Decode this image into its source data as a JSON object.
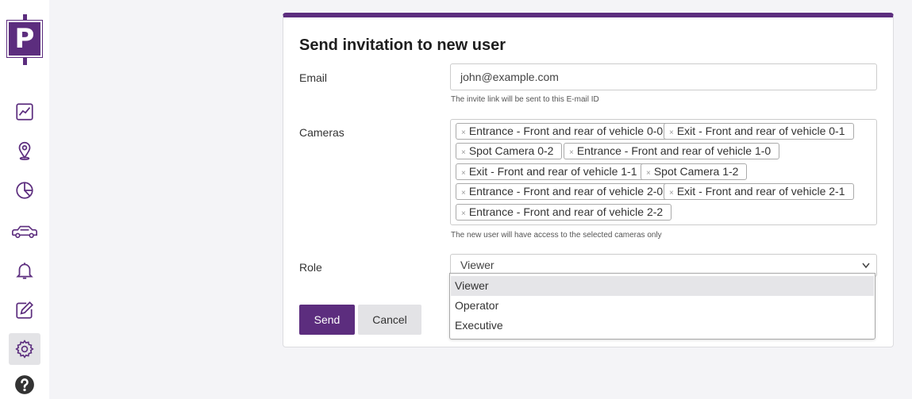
{
  "sidebar": {
    "logo_letter": "P",
    "items": [
      {
        "icon": "chart-line-icon"
      },
      {
        "icon": "map-pin-icon"
      },
      {
        "icon": "pie-chart-icon"
      },
      {
        "icon": "car-icon"
      },
      {
        "icon": "bell-icon"
      },
      {
        "icon": "edit-icon"
      },
      {
        "icon": "gear-icon",
        "active": true
      },
      {
        "icon": "help-icon"
      }
    ]
  },
  "form": {
    "title": "Send invitation to new user",
    "email_label": "Email",
    "email_value": "john@example.com",
    "email_help": "The invite link will be sent to this E-mail ID",
    "cameras_label": "Cameras",
    "cameras": [
      "Entrance - Front and rear of vehicle 0-0",
      "Exit - Front and rear of vehicle 0-1",
      "Spot Camera 0-2",
      "Entrance - Front and rear of vehicle 1-0",
      "Exit - Front and rear of vehicle 1-1",
      "Spot Camera 1-2",
      "Entrance - Front and rear of vehicle 2-0",
      "Exit - Front and rear of vehicle 2-1",
      "Entrance - Front and rear of vehicle 2-2"
    ],
    "tag_remove": "×",
    "cameras_help": "The new user will have access to the selected cameras only",
    "role_label": "Role",
    "role_value": "Viewer",
    "role_options": [
      "Viewer",
      "Operator",
      "Executive"
    ],
    "send_label": "Send",
    "cancel_label": "Cancel"
  },
  "colors": {
    "accent": "#5c2d7e",
    "button_secondary": "#e3e3e6"
  }
}
